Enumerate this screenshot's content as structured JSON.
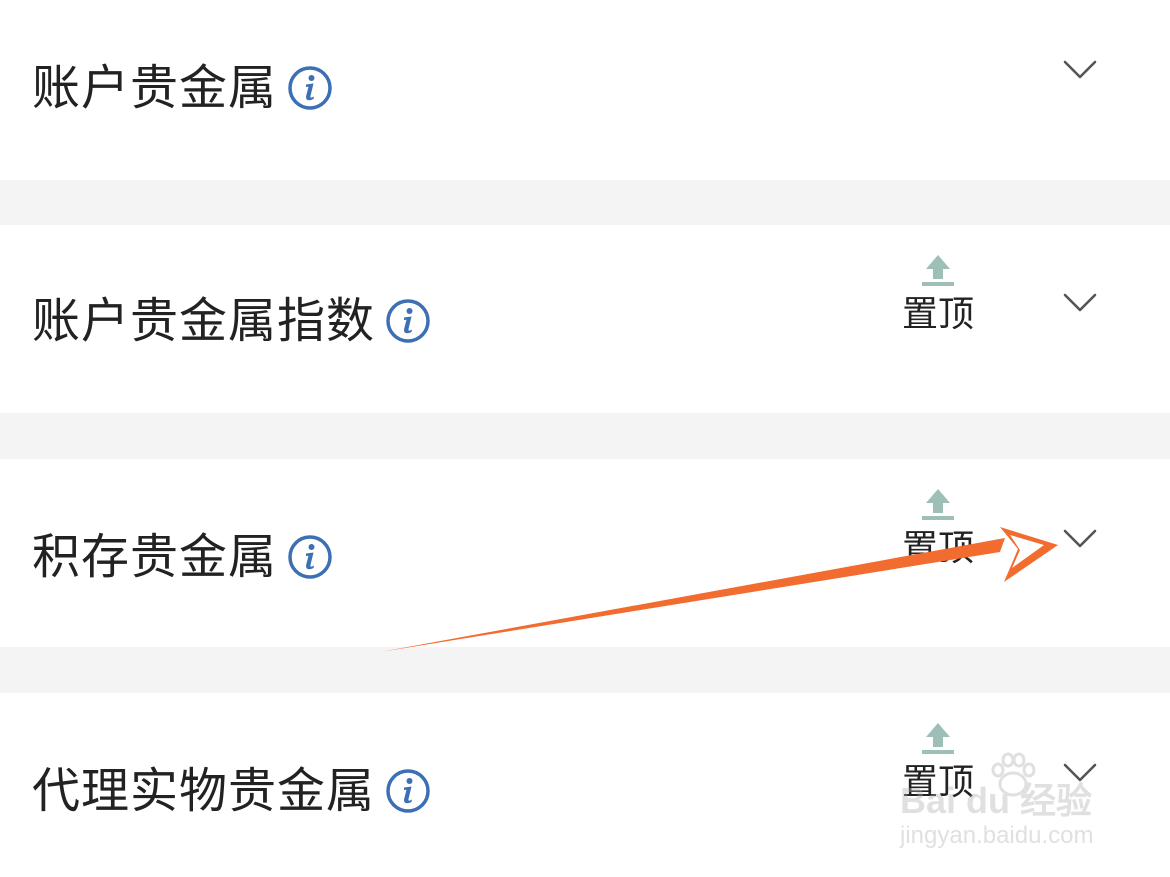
{
  "items": [
    {
      "title": "账户贵金属",
      "has_pin": false,
      "pin_label": ""
    },
    {
      "title": "账户贵金属指数",
      "has_pin": true,
      "pin_label": "置顶"
    },
    {
      "title": "积存贵金属",
      "has_pin": true,
      "pin_label": "置顶"
    },
    {
      "title": "代理实物贵金属",
      "has_pin": true,
      "pin_label": "置顶"
    }
  ],
  "icons": {
    "info": "info-circle-icon",
    "pin": "pin-to-top-icon",
    "expand": "chevron-down-icon"
  },
  "colors": {
    "info_blue": "#3d6fb5",
    "pin_teal": "#9dbfb8",
    "annotation_arrow": "#f26b2f",
    "divider_gray": "#f4f4f4"
  },
  "watermark": {
    "brand": "Bai du 经验",
    "url": "jingyan.baidu.com"
  }
}
